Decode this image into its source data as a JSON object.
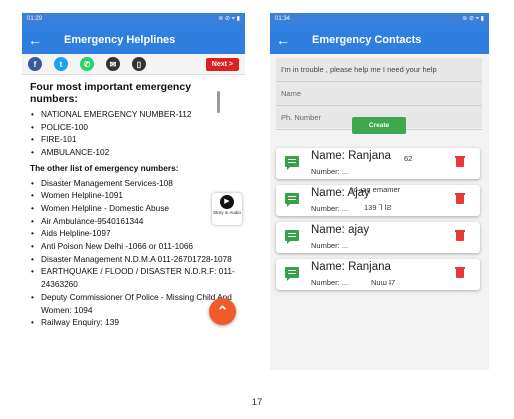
{
  "page_number": "17",
  "left_screen": {
    "status": {
      "time": "01:29",
      "right": "≋ ⊘ ⌖ ▮"
    },
    "app_bar_title": "Emergency Helplines",
    "share_next_label": "Next >",
    "heading": "Four most important emergency numbers:",
    "top_numbers": [
      "NATIONAL EMERGENCY NUMBER-112",
      "POLICE-100",
      "FIRE-101",
      "AMBULANCE-102"
    ],
    "other_heading": "The other list of emergency numbers:",
    "other_numbers": [
      "Disaster Management Services-108",
      "Women Helpline-1091",
      "Women Helpline - Domestic Abuse",
      "Air Ambulance-9540161344",
      "Aids Helpline-1097",
      "Anti Poison New Delhi -1066 or 011-1066",
      "Disaster Management N.D.M.A 011-26701728-1078",
      "EARTHQUAKE / FLOOD / DISASTER N.D.R.F: 011-24363260",
      "Deputy Commissioner Of Police - Missing Child And Women: 1094",
      "Railway Enquiry: 139"
    ],
    "story_label": "Story in Audio",
    "fab_icon": "chevron-up"
  },
  "right_screen": {
    "status": {
      "time": "01:34",
      "right": "≋ ⊘ ⌖ ▮"
    },
    "app_bar_title": "Emergency Contacts",
    "message_value": "I'm in trouble , please help me I need your help",
    "name_placeholder": "Name",
    "phone_placeholder": "Ph. Number",
    "create_label": "Create",
    "contacts": [
      {
        "name": "Name: Ranjana",
        "number": "Number: ...",
        "overlay": "62"
      },
      {
        "name": "Name: Ajay",
        "number": "Number: ...",
        "overlay": "ro ɹəq emamer"
      },
      {
        "name": "Name: ajay",
        "number": "Number: ...",
        "overlay": "139   ⅂ ƖƧ"
      },
      {
        "name": "Name: Ranjana",
        "number": "Number: ...",
        "overlay": "Nuɯ ʇ7"
      }
    ]
  }
}
